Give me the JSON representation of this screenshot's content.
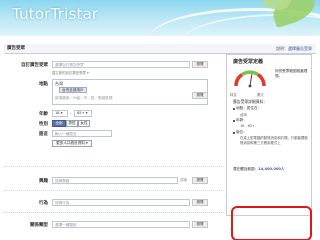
{
  "banner": {
    "logo_text": "TutorTristar"
  },
  "page": {
    "title": "廣告受眾",
    "help_link": "說明：選擇廣告受眾"
  },
  "form": {
    "custom_audience": {
      "label": "自訂廣告受眾",
      "input_placeholder": "選擇自訂廣告受眾",
      "browse": "瀏覽",
      "hint": "建立新的自訂廣告受眾 ▾"
    },
    "location": {
      "label": "地點",
      "selected_country": "台灣",
      "selected_scope": "台灣全部用戶",
      "input_placeholder": "新增國家／州省／市／區／郵遞區號",
      "browse": "瀏覽"
    },
    "age": {
      "label": "年齡",
      "min": "18 ▾",
      "dash": "-",
      "max": "65+ ▾"
    },
    "gender": {
      "label": "性別",
      "options": [
        "全部",
        "男性",
        "女性"
      ],
      "active_index": 0
    },
    "language": {
      "label": "語言",
      "placeholder": "輸入一種語言"
    },
    "more": {
      "label": "更多人口統計資料 ▾"
    },
    "interests": {
      "label": "興趣",
      "placeholder": "搜尋興趣",
      "suggest": "建議",
      "browse": "瀏覽"
    },
    "behaviors": {
      "label": "行為",
      "placeholder": "搜尋行為",
      "browse": "瀏覽"
    },
    "connections": {
      "label": "關係類型",
      "placeholder": "選擇一種類型",
      "browse": "瀏覽"
    }
  },
  "audience_panel": {
    "title": "廣告受眾定義",
    "gauge_left": "特定",
    "gauge_right": "廣泛",
    "gauge_caption": "你的受眾範圍相當理想。",
    "gauge_level": 0.55,
    "details_title": "廣告受眾詳細資料：",
    "bullets": [
      {
        "label": "地點：居住在：",
        "value": "台灣"
      },
      {
        "label": "年齡：",
        "value": "18 - 65+"
      },
      {
        "label": "版位：",
        "value": "在桌上型電腦的動態消息和右欄，行動裝置動態消息和第三方應用程式上"
      }
    ],
    "reach_label": "潛在觸及範圍：",
    "reach_value": "14,400,000人"
  },
  "colors": {
    "accent": "#3b5998",
    "highlight": "#e01818",
    "needle": "#e03a2e",
    "gauge_green": "#7cc24a"
  }
}
